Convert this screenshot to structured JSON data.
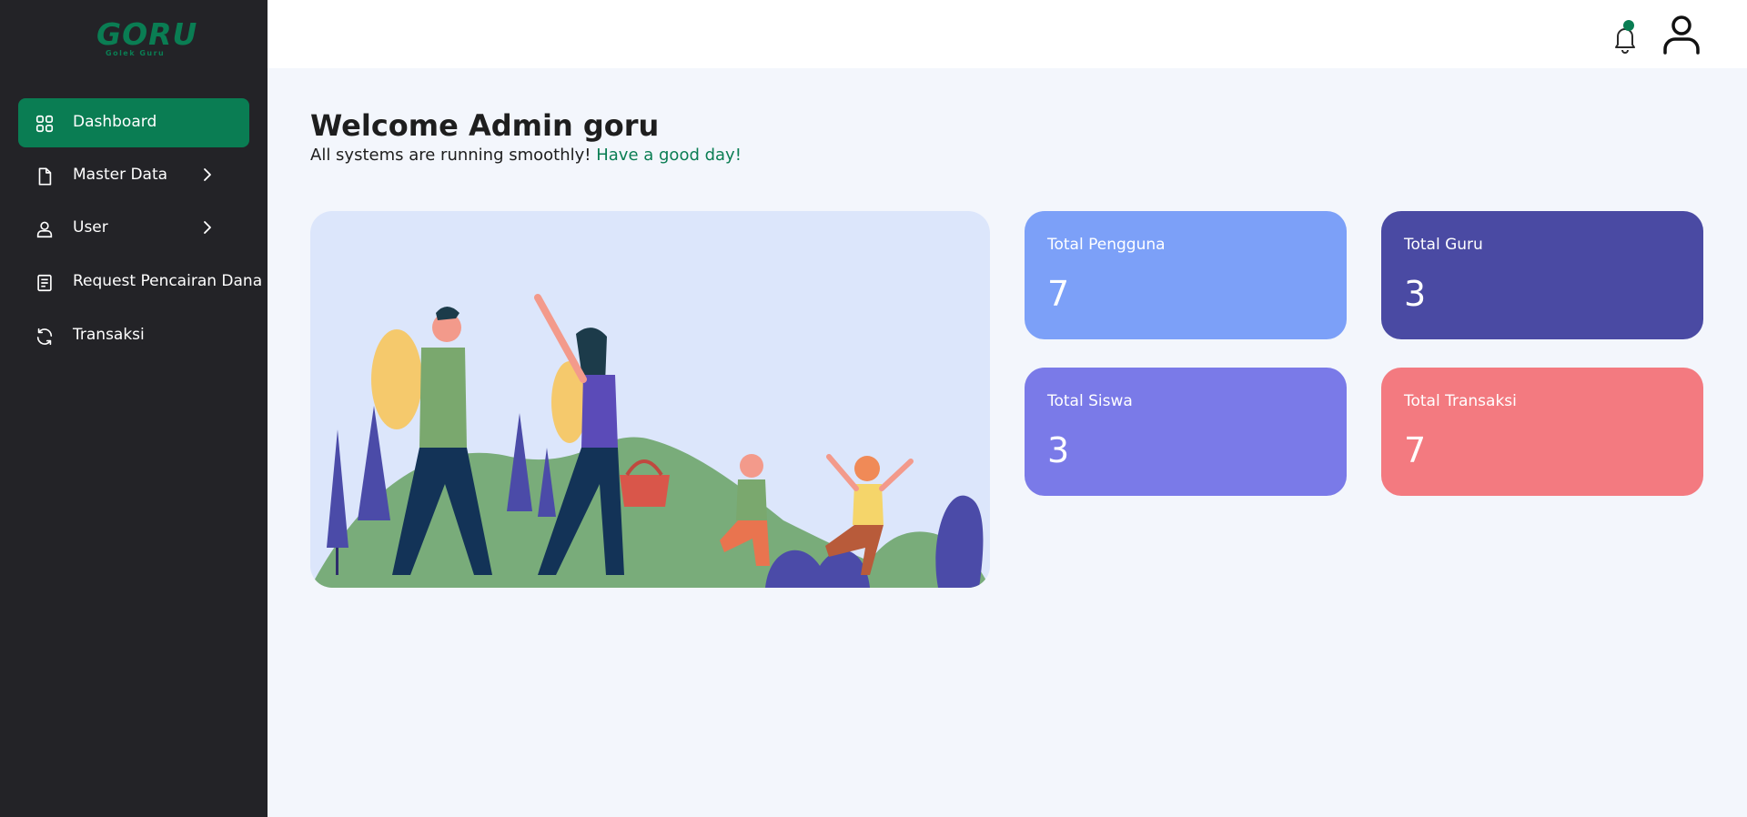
{
  "app": {
    "logo_text": "GORU",
    "logo_tagline": "Golek Guru"
  },
  "sidebar": {
    "items": [
      {
        "label": "Dashboard",
        "icon": "grid-icon",
        "active": true
      },
      {
        "label": "Master Data",
        "icon": "document-icon",
        "has_submenu": true
      },
      {
        "label": "User",
        "icon": "user-icon",
        "has_submenu": true
      },
      {
        "label": "Request Pencairan Dana",
        "icon": "receipt-icon"
      },
      {
        "label": "Transaksi",
        "icon": "refresh-icon"
      }
    ]
  },
  "header": {
    "icons": [
      "bell-icon",
      "user-avatar-icon"
    ]
  },
  "main": {
    "title": "Welcome Admin goru",
    "subtitle": "All systems are running smoothly!",
    "subtitle_accent": "Have a good day!"
  },
  "stats": [
    {
      "label": "Total Pengguna",
      "value": "7",
      "color": "#7ca0f8"
    },
    {
      "label": "Total Guru",
      "value": "3",
      "color": "#4a4aa3"
    },
    {
      "label": "Total Siswa",
      "value": "3",
      "color": "#7a7ae8"
    },
    {
      "label": "Total Transaksi",
      "value": "7",
      "color": "#f37a80"
    }
  ],
  "colors": {
    "sidebar_bg": "#232327",
    "accent": "#0a7d53",
    "page_bg": "#f3f6fc"
  }
}
